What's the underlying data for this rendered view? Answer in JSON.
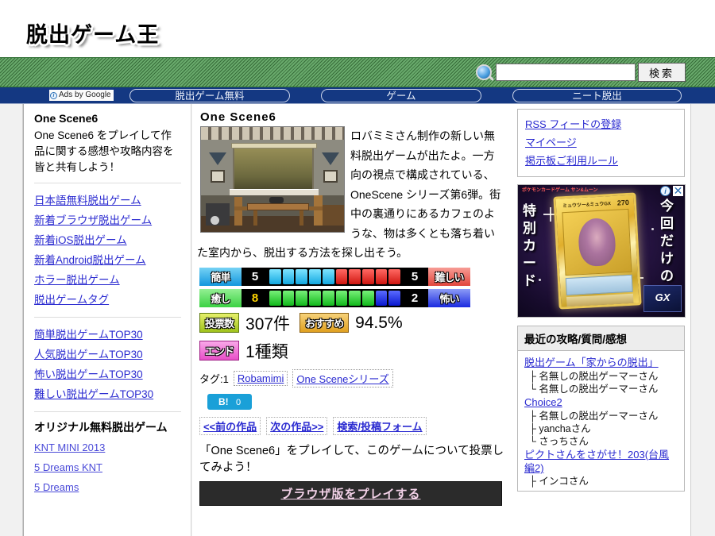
{
  "header": {
    "logo": "脱出ゲーム王"
  },
  "search": {
    "placeholder": "",
    "value": "",
    "button_label": "検索",
    "icon": "search-icon"
  },
  "navbar": {
    "ads_label": "Ads by Google",
    "pills": [
      "脱出ゲーム無料",
      "ゲーム",
      "ニート脱出"
    ]
  },
  "left_sidebar": {
    "title": "One Scene6",
    "description": "One Scene6 をプレイして作品に関する感想や攻略内容を皆と共有しよう！",
    "links_primary": [
      "日本語無料脱出ゲーム",
      "新着ブラウザ脱出ゲーム",
      "新着iOS脱出ゲーム",
      "新着Android脱出ゲーム",
      "ホラー脱出ゲーム",
      "脱出ゲームタグ"
    ],
    "links_rankings": [
      "簡単脱出ゲームTOP30",
      "人気脱出ゲームTOP30",
      "怖い脱出ゲームTOP30",
      "難しい脱出ゲームTOP30"
    ],
    "original_heading": "オリジナル無料脱出ゲーム",
    "links_original": [
      "KNT MINI 2013",
      "5 Dreams KNT",
      "5 Dreams"
    ]
  },
  "main": {
    "title": "One Scene6",
    "thumbnail_alt": "One Scene6 ゲーム画面",
    "intro": "ロバミミさん制作の新しい無料脱出ゲームが出たよ。一方向の視点で構成されている、OneScene シリーズ第6弾。街中の裏通りにあるカフェのような、物は多くとも落ち着いた室内から、脱出する方法を探し出そう。",
    "ratings": [
      {
        "left_label": "簡単",
        "left_value": "5",
        "left_filled": 5,
        "left_color": "#13a8e0",
        "right_label": "難しい",
        "right_value": "5",
        "right_filled": 5,
        "right_color": "#d01610"
      },
      {
        "left_label": "癒し",
        "left_value": "8",
        "left_filled": 8,
        "left_color": "#11b81b",
        "right_label": "怖い",
        "right_value": "2",
        "right_filled": 2,
        "right_color": "#0a18cf"
      }
    ],
    "stats": {
      "votes_label": "投票数",
      "votes_value": "307件",
      "reco_label": "おすすめ",
      "reco_value": "94.5%",
      "end_label": "エンド",
      "end_value": "1種類"
    },
    "tags": {
      "prefix": "タグ:1",
      "items": [
        "Robamimi",
        "One Sceneシリーズ"
      ]
    },
    "bookmark": {
      "label": "B!",
      "count": "0"
    },
    "nav_links": [
      "<<前の作品",
      "次の作品>>",
      "検索/投稿フォーム"
    ],
    "cta_text": "「One Scene6」をプレイして、このゲームについて投票してみよう！",
    "play_button": "ブラウザ版をプレイする"
  },
  "right_sidebar": {
    "links": [
      "RSS フィードの登録",
      "マイページ",
      "掲示板ご利用ルール"
    ],
    "ad": {
      "left_text": "特別カード",
      "right_text": "今回だけの",
      "brand": "ポケモンカードゲーム サン&ムーン",
      "card_name": "ミュウツー&ミュウGX",
      "card_hp": "270",
      "gx_label": "GX",
      "info_icon": "info-icon",
      "close_icon": "close-icon"
    },
    "recent": {
      "heading": "最近の攻略/質問/感想",
      "threads": [
        {
          "title": "脱出ゲーム「家からの脱出」",
          "replies": [
            "├ 名無しの脱出ゲーマーさん",
            "└ 名無しの脱出ゲーマーさん"
          ]
        },
        {
          "title": "Choice2",
          "replies": [
            "├ 名無しの脱出ゲーマーさん",
            "├ yanchaさん",
            "└ さっちさん"
          ]
        },
        {
          "title": "ピクトさんをさがせ！203(台風編2)",
          "replies": [
            "├ インコさん"
          ]
        }
      ]
    }
  },
  "colors": {
    "brand_green": "#4f9b52",
    "nav_blue": "#143882",
    "link_blue": "#2a2ad0",
    "easy_cyan": "#13a8e0",
    "hard_red": "#d01610",
    "heal_green": "#11b81b",
    "scary_blue": "#0a18cf",
    "bookmark_blue": "#1aa0d8"
  }
}
